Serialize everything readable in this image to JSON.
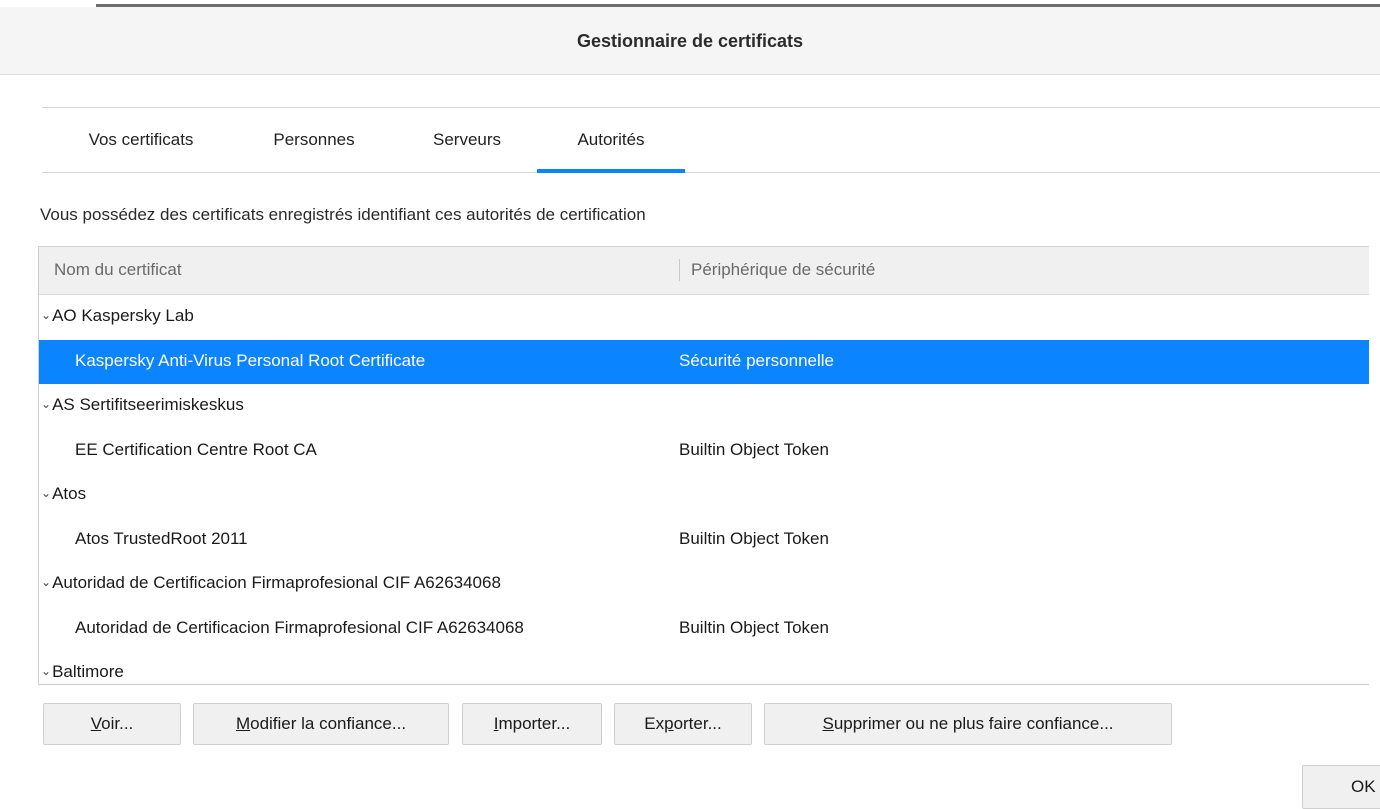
{
  "window": {
    "title": "Gestionnaire de certificats"
  },
  "tabs": [
    {
      "label": "Vos certificats",
      "active": false
    },
    {
      "label": "Personnes",
      "active": false
    },
    {
      "label": "Serveurs",
      "active": false
    },
    {
      "label": "Autorités",
      "active": true
    }
  ],
  "description": "Vous possédez des certificats enregistrés identifiant ces autorités de certification",
  "tree": {
    "columns": [
      "Nom du certificat",
      "Périphérique de sécurité"
    ],
    "rows": [
      {
        "type": "group",
        "name": "AO Kaspersky Lab",
        "device": ""
      },
      {
        "type": "child",
        "name": "Kaspersky Anti-Virus Personal Root Certificate",
        "device": "Sécurité personnelle",
        "selected": true
      },
      {
        "type": "group",
        "name": "AS Sertifitseerimiskeskus",
        "device": ""
      },
      {
        "type": "child",
        "name": "EE Certification Centre Root CA",
        "device": "Builtin Object Token"
      },
      {
        "type": "group",
        "name": "Atos",
        "device": ""
      },
      {
        "type": "child",
        "name": "Atos TrustedRoot 2011",
        "device": "Builtin Object Token"
      },
      {
        "type": "group",
        "name": "Autoridad de Certificacion Firmaprofesional CIF A62634068",
        "device": ""
      },
      {
        "type": "child",
        "name": "Autoridad de Certificacion Firmaprofesional CIF A62634068",
        "device": "Builtin Object Token"
      },
      {
        "type": "group",
        "name": "Baltimore",
        "device": ""
      }
    ],
    "twisty": "⌄"
  },
  "buttons": {
    "view": {
      "key": "V",
      "rest": "oir..."
    },
    "edit_trust": {
      "key": "M",
      "rest": "odifier la confiance..."
    },
    "import": {
      "key": "I",
      "rest": "mporter..."
    },
    "export_pre": "Ex",
    "export": {
      "key": "p",
      "rest": "orter..."
    },
    "delete": {
      "key": "S",
      "rest": "upprimer ou ne plus faire confiance..."
    },
    "ok": "OK"
  },
  "colors": {
    "accent": "#0a84ff",
    "selected_row": "#0a84ff"
  }
}
